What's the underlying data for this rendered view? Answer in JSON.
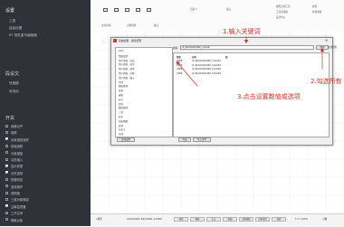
{
  "left_panel": {
    "title": "设置",
    "settings_items": [
      "工具",
      "缺省设置",
      "RT 视觉重写编辑器"
    ],
    "general_section": "段设文",
    "general_items": [
      "快捷键",
      "其他设"
    ],
    "toggle_section": "开关",
    "toggles": [
      {
        "label": "网格对齐",
        "checked": false
      },
      {
        "label": "吸附",
        "checked": false
      },
      {
        "label": "对象捕捉追踪",
        "checked": true
      },
      {
        "label": "极轴追踪",
        "checked": false
      },
      {
        "label": "对象捕捉",
        "checked": false
      },
      {
        "label": "动态输入",
        "checked": false
      },
      {
        "label": "显示线宽",
        "checked": true
      },
      {
        "label": "允许选择",
        "checked": true
      },
      {
        "label": "快捷特性",
        "checked": false
      },
      {
        "label": "选择循环",
        "checked": false
      },
      {
        "label": "透明度",
        "checked": false
      },
      {
        "label": "三维对象捕捉",
        "checked": false
      },
      {
        "label": "注释监视器",
        "checked": true
      },
      {
        "label": "工作空间",
        "checked": false
      },
      {
        "label": "隔离对象",
        "checked": false
      }
    ]
  },
  "ribbon": {
    "group_labels": [
      "显示控制",
      "对象管理",
      "视口",
      "自定义",
      "窗口"
    ],
    "right_items": [
      "图形实用工具",
      "工具选项板",
      "设计中心",
      "属性",
      "外部参照"
    ]
  },
  "dialog": {
    "title": "系统变量 - 搜索结果",
    "search_label": "搜索:",
    "search_value": "ID_BACKGROUND_COLOR",
    "search_button": "搜索",
    "filter_button": "过滤所有",
    "tree": [
      "CAD",
      "绘图设置",
      "用户界面 - 启动",
      "用户界面 - 显示",
      "用户界面 - 菜单",
      "用户界面 - 外观",
      "用户界面 - 输入",
      "文件",
      "图形管理",
      "选择",
      "编辑",
      "标注",
      "打印",
      "图形管理",
      "三维",
      "显示",
      "动态观察",
      "其他",
      "自定义",
      "全部"
    ],
    "columns": [
      "类型",
      "名称",
      "值"
    ],
    "rows": [
      [
        "USER",
        "ID_BACKGROUND_COLOR1",
        ""
      ],
      [
        "USER",
        "ID_BACKGROUND_COLOR2",
        ""
      ],
      [
        "USER",
        "ID_BACKGROUND_COLOR3",
        ""
      ],
      [
        "USER",
        "ID_BACKGROUND_COLOR4",
        ""
      ]
    ],
    "buttons": [
      "查找设置",
      "导出",
      "导入文件"
    ]
  },
  "annotations": {
    "step1": "1.输入关键词",
    "step2": "2.勾选所有",
    "step3": "3.点击设置数值或选项"
  },
  "status_bar": {
    "model": "Ⅰ 模型",
    "coords": "1250.0000, 892.0000, 0.0000",
    "toggles": [
      "捕捉",
      "栅格",
      "正交",
      "极轴",
      "对象捕捉",
      "对象追踪",
      "线宽"
    ],
    "zoom": "1:1 / 100%",
    "decimal": "小数"
  },
  "colors": {
    "accent": "#e0281e",
    "panel": "#2f3237"
  }
}
